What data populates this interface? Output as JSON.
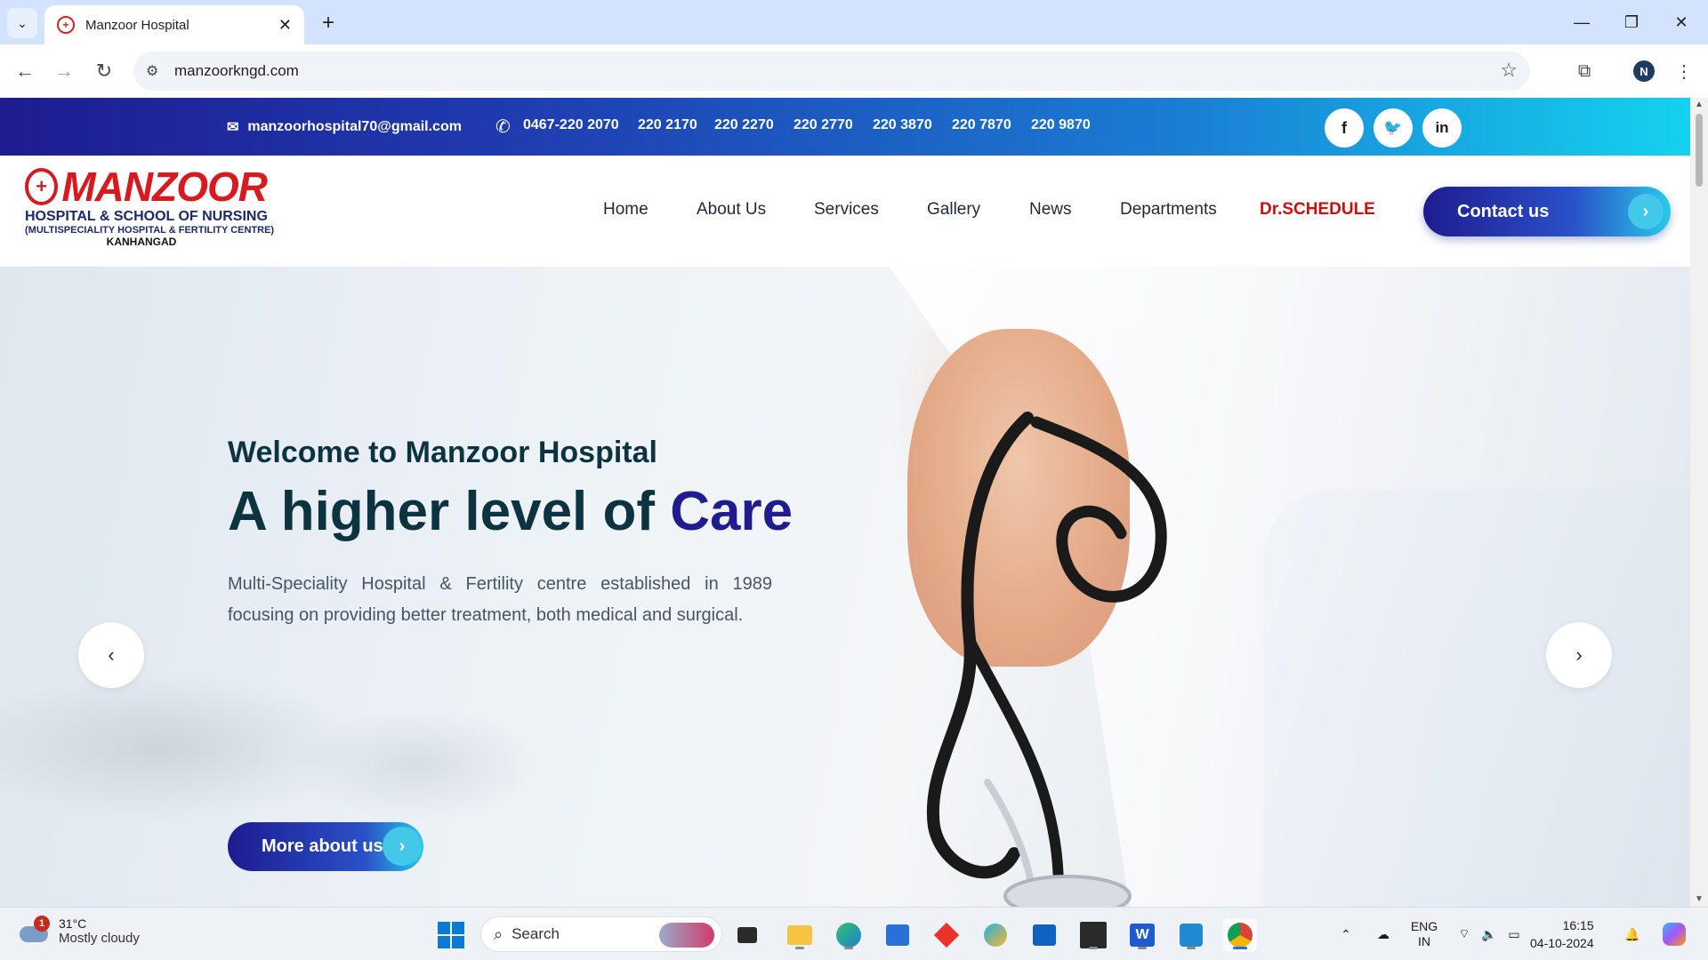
{
  "browser": {
    "tab_title": "Manzoor Hospital",
    "tab_close": "✕",
    "new_tab": "+",
    "url": "manzoorkngd.com",
    "profile_initial": "N"
  },
  "topbar": {
    "email": "manzoorhospital70@gmail.com",
    "phones": [
      "0467-220 2070",
      "220 2170",
      "220 2270",
      "220 2770",
      "220 3870",
      "220 7870",
      "220 9870"
    ],
    "social": [
      {
        "icon": "facebook-icon",
        "glyph": "f"
      },
      {
        "icon": "twitter-icon",
        "glyph": "🐦"
      },
      {
        "icon": "linkedin-icon",
        "glyph": "in"
      }
    ]
  },
  "logo": {
    "wordmark": "MANZOOR",
    "line2": "HOSPITAL & SCHOOL OF NURSING",
    "line3": "(MULTISPECIALITY HOSPITAL & FERTILITY CENTRE)",
    "line4": "KANHANGAD"
  },
  "nav": {
    "items": [
      "Home",
      "About Us",
      "Services",
      "Gallery",
      "News",
      "Departments",
      "Dr.SCHEDULE"
    ],
    "contact_label": "Contact us"
  },
  "hero": {
    "subtitle": "Welcome to Manzoor Hospital",
    "title_main": "A higher level of ",
    "title_accent": "Care",
    "description": "Multi-Speciality Hospital & Fertility centre established in 1989 focusing on providing better treatment, both medical and surgical.",
    "button_label": "More about us"
  },
  "taskbar": {
    "weather_badge": "1",
    "temperature": "31°C",
    "weather_desc": "Mostly cloudy",
    "search_label": "Search",
    "lang_line1": "ENG",
    "lang_line2": "IN",
    "time": "16:15",
    "date": "04-10-2024"
  },
  "colors": {
    "brand_red": "#d71920",
    "brand_navy": "#1e1c8f",
    "heading_dark": "#0d3340",
    "accent_cyan": "#29c9ea"
  }
}
